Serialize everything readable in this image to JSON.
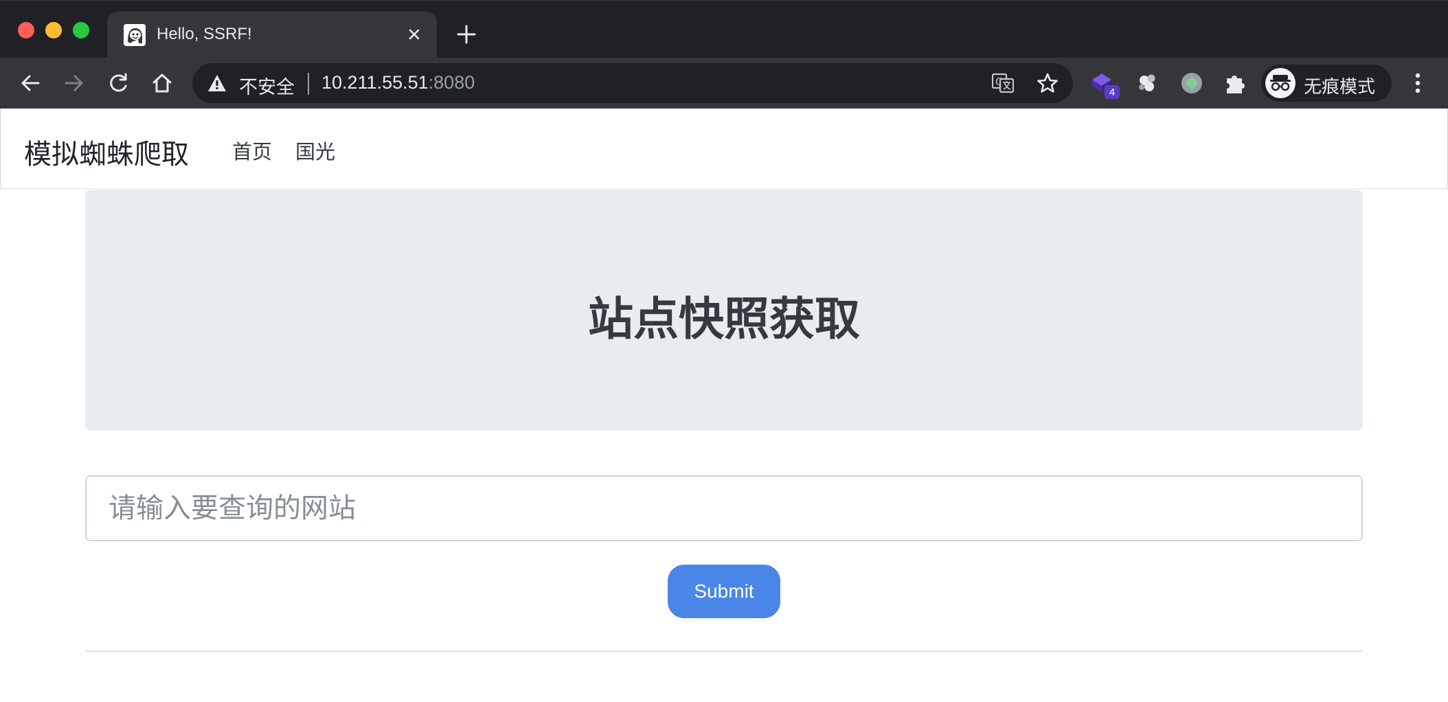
{
  "browser": {
    "tab": {
      "title": "Hello, SSRF!",
      "favicon": "meme-face-icon"
    },
    "address_bar": {
      "security_label": "不安全",
      "host": "10.211.55.51",
      "port": ":8080"
    },
    "extensions": [
      {
        "name": "purple-cube-extension",
        "badge": "4",
        "color": "#5b3cc4"
      },
      {
        "name": "gray-circles-extension"
      },
      {
        "name": "green-dot-extension",
        "color": "#81c995"
      },
      {
        "name": "puzzle-extensions-icon"
      }
    ],
    "profile": {
      "label": "无痕模式"
    },
    "colors": {
      "frame": "#202124",
      "toolbar": "#35363a",
      "text": "#e8eaed",
      "muted": "#9aa0a6"
    }
  },
  "navbar": {
    "brand": "模拟蜘蛛爬取",
    "links": [
      {
        "label": "首页"
      },
      {
        "label": "国光"
      }
    ]
  },
  "main": {
    "heading": "站点快照获取",
    "url_input": {
      "placeholder": "请输入要查询的网站",
      "value": ""
    },
    "submit_label": "Submit",
    "colors": {
      "jumbotron_bg": "#e9ecef",
      "submit_bg": "#4a86e8"
    }
  }
}
